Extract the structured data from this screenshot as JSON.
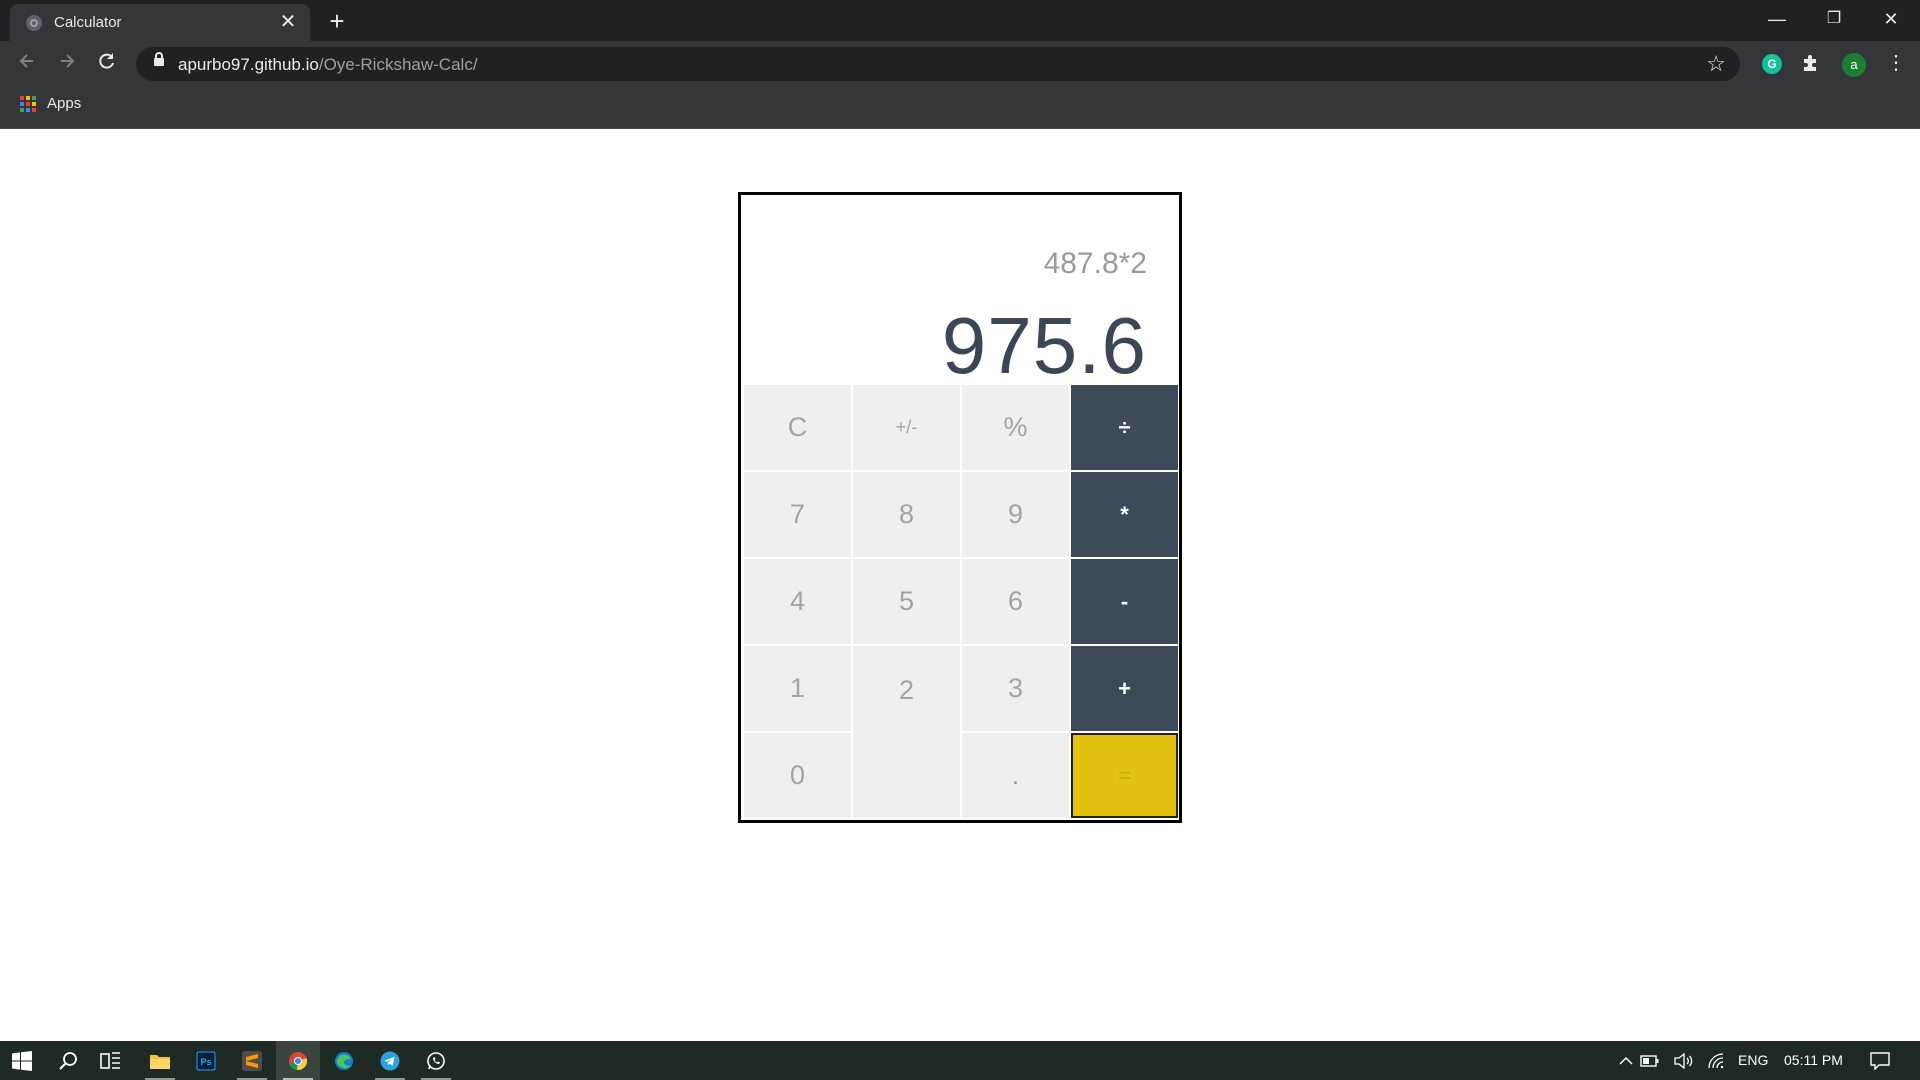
{
  "browser": {
    "tab_title": "Calculator",
    "tab_close": "✕",
    "new_tab": "+",
    "url_host": "apurbo97.github.io",
    "url_path": "/Oye-Rickshaw-Calc/",
    "extension_avatar": "a",
    "extension_grammarly": "G",
    "bookmarks_apps_label": "Apps",
    "window_buttons": [
      "—",
      "❐",
      "✕"
    ]
  },
  "calculator": {
    "expression": "487.8*2",
    "result": "975.6",
    "keys": [
      {
        "label": "C",
        "kind": "fn"
      },
      {
        "label": "+/-",
        "kind": "fn"
      },
      {
        "label": "%",
        "kind": "fn"
      },
      {
        "label": "÷",
        "kind": "op"
      },
      {
        "label": "7",
        "kind": "num"
      },
      {
        "label": "8",
        "kind": "num"
      },
      {
        "label": "9",
        "kind": "num"
      },
      {
        "label": "*",
        "kind": "op"
      },
      {
        "label": "4",
        "kind": "num"
      },
      {
        "label": "5",
        "kind": "num"
      },
      {
        "label": "6",
        "kind": "num"
      },
      {
        "label": "-",
        "kind": "op"
      },
      {
        "label": "1",
        "kind": "num"
      },
      {
        "label": "2",
        "kind": "num"
      },
      {
        "label": "3",
        "kind": "num"
      },
      {
        "label": "+",
        "kind": "op"
      },
      {
        "label": "0",
        "kind": "num"
      },
      {
        "label": ".",
        "kind": "num"
      },
      {
        "label": "=",
        "kind": "equals"
      }
    ],
    "colors": {
      "operator_bg": "#3d4a5a",
      "equals_bg": "#e3c110",
      "key_bg": "#efefef",
      "result_text": "#3d4655"
    }
  },
  "taskbar": {
    "language": "ENG",
    "time": "05:11 PM",
    "pinned": [
      "windows-start-icon",
      "search-icon",
      "task-view-icon",
      "file-explorer-icon",
      "photoshop-icon",
      "sublime-text-icon",
      "chrome-icon",
      "edge-icon",
      "telegram-icon",
      "whatsapp-icon"
    ]
  }
}
